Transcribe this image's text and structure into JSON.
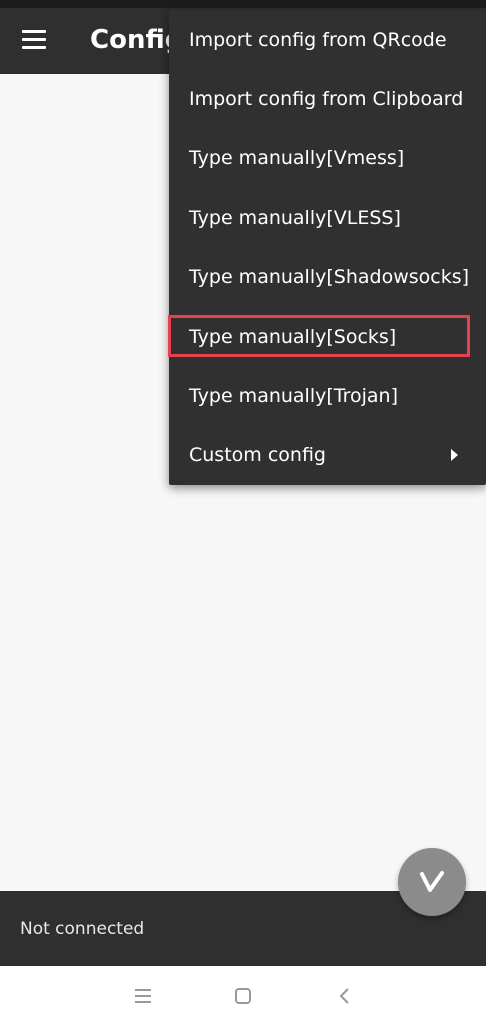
{
  "toolbar": {
    "title": "Config"
  },
  "menu": {
    "items": [
      {
        "label": "Import config from QRcode"
      },
      {
        "label": "Import config from Clipboard"
      },
      {
        "label": "Type manually[Vmess]"
      },
      {
        "label": "Type manually[VLESS]"
      },
      {
        "label": "Type manually[Shadowsocks]"
      },
      {
        "label": "Type manually[Socks]"
      },
      {
        "label": "Type manually[Trojan]"
      },
      {
        "label": "Custom config"
      }
    ]
  },
  "status": {
    "text": "Not connected"
  },
  "colors": {
    "toolbar": "#2f2f2f",
    "menu_background": "#303030",
    "highlight": "#e8404d",
    "fab": "#8b8b8b",
    "background": "#f7f7f7"
  },
  "icons": {
    "menu": "hamburger-icon",
    "fab": "v-logo-icon",
    "submenu": "chevron-right-icon",
    "nav": [
      "recents-icon",
      "home-icon",
      "back-icon"
    ]
  }
}
